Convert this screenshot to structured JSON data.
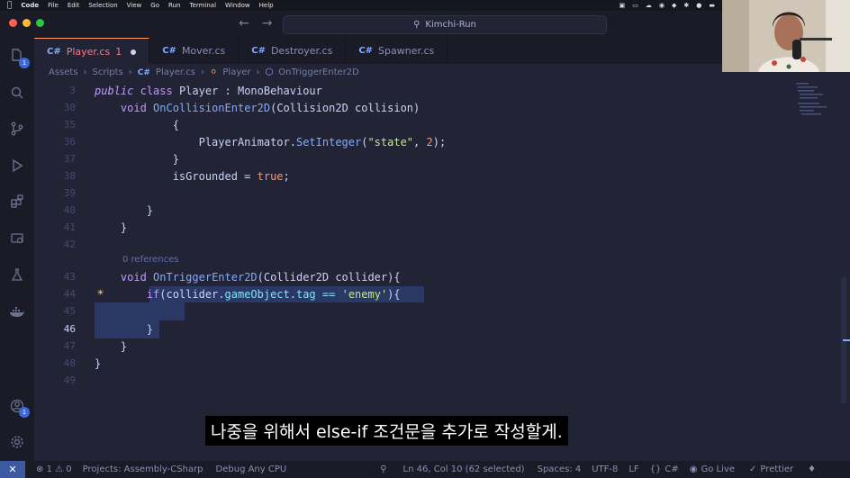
{
  "menubar": {
    "app": "Code",
    "items": [
      "File",
      "Edit",
      "Selection",
      "View",
      "Go",
      "Run",
      "Terminal",
      "Window",
      "Help"
    ]
  },
  "titlebar": {
    "search_text": "Kimchi-Run"
  },
  "tabs": [
    {
      "label": "Player.cs",
      "badge": "1",
      "modified": true,
      "active": true
    },
    {
      "label": "Mover.cs",
      "active": false
    },
    {
      "label": "Destroyer.cs",
      "active": false
    },
    {
      "label": "Spawner.cs",
      "active": false
    }
  ],
  "tab_icon_text": "C#",
  "breadcrumb": [
    "Assets",
    "Scripts",
    "Player.cs",
    "Player",
    "OnTriggerEnter2D"
  ],
  "activity": {
    "explorer_badge": "1",
    "accounts_badge": "1"
  },
  "editor": {
    "codelens": "0 references",
    "lines": [
      {
        "n": "3",
        "t": "public class Player : MonoBehaviour"
      },
      {
        "n": "30",
        "t": "    void OnCollisionEnter2D(Collision2D collision)"
      },
      {
        "n": "35",
        "t": "            {"
      },
      {
        "n": "36",
        "t": "                PlayerAnimator.SetInteger(\"state\", 2);"
      },
      {
        "n": "37",
        "t": "            }"
      },
      {
        "n": "38",
        "t": "            isGrounded = true;"
      },
      {
        "n": "39",
        "t": ""
      },
      {
        "n": "40",
        "t": "        }"
      },
      {
        "n": "41",
        "t": "    }"
      },
      {
        "n": "42",
        "t": ""
      },
      {
        "n": "43",
        "t": "    void OnTriggerEnter2D(Collider2D collider){"
      },
      {
        "n": "44",
        "t": "        if(collider.gameObject.tag == 'enemy'){"
      },
      {
        "n": "45",
        "t": ""
      },
      {
        "n": "46",
        "t": "        }"
      },
      {
        "n": "47",
        "t": "    }"
      },
      {
        "n": "48",
        "t": "}"
      },
      {
        "n": "49",
        "t": ""
      }
    ]
  },
  "subtitle": "나중을 위해서 else-if 조건문을 추가로 작성할게.",
  "statusbar": {
    "errors": "1",
    "warnings": "0",
    "project": "Projects: Assembly-CSharp",
    "debug": "Debug Any CPU",
    "position": "Ln 46, Col 10 (62 selected)",
    "spaces": "Spaces: 4",
    "encoding": "UTF-8",
    "eol": "LF",
    "language": "C#",
    "golive": "Go Live",
    "prettier": "Prettier"
  },
  "colors": {
    "editor_bg": "#222436",
    "keyword": "#c099ff",
    "function": "#82aaff",
    "string": "#c3e88d",
    "number": "#ff966c"
  }
}
